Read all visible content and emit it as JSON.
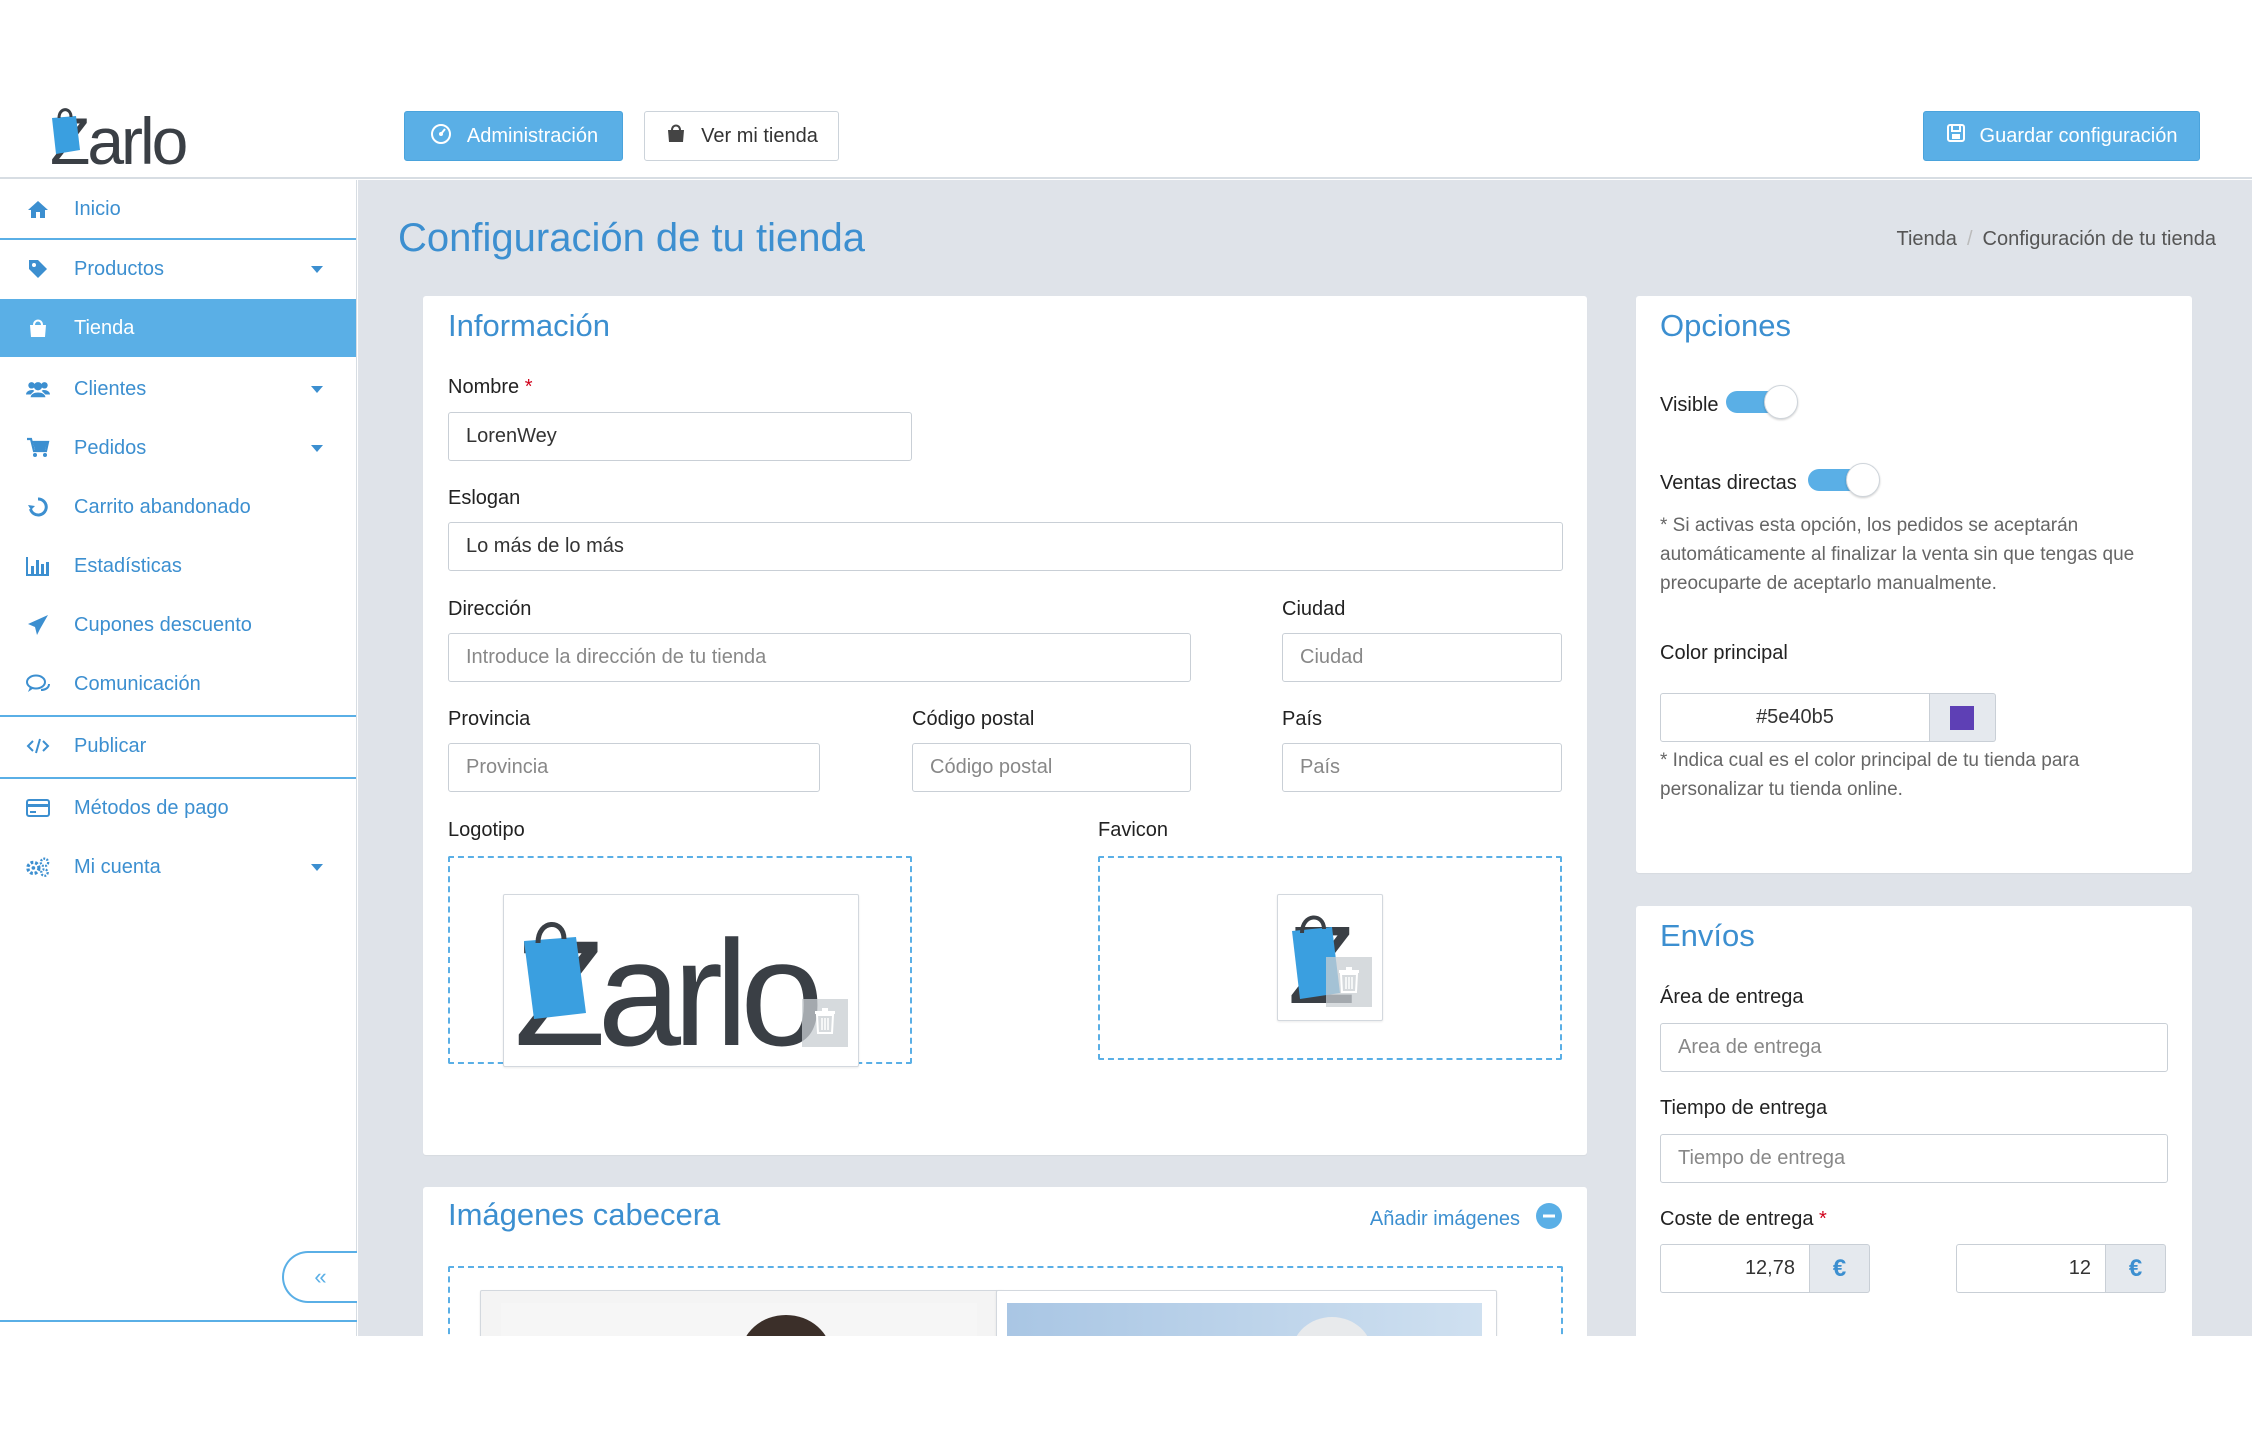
{
  "brand": {
    "logo_text": "Zarlo",
    "accent": "#5aafe6",
    "link": "#3c8fd0"
  },
  "topbar": {
    "admin_label": "Administración",
    "store_label": "Ver mi tienda",
    "save_label": "Guardar configuración"
  },
  "sidebar": {
    "items": [
      {
        "label": "Inicio",
        "icon": "home-icon"
      },
      {
        "label": "Productos",
        "icon": "tag-icon"
      },
      {
        "label": "Tienda",
        "icon": "shopping-bag-icon"
      },
      {
        "label": "Clientes",
        "icon": "users-icon"
      },
      {
        "label": "Pedidos",
        "icon": "cart-icon"
      },
      {
        "label": "Carrito abandonado",
        "icon": "recycle-icon"
      },
      {
        "label": "Estadísticas",
        "icon": "bar-chart-icon"
      },
      {
        "label": "Cupones descuento",
        "icon": "paper-plane-icon"
      },
      {
        "label": "Comunicación",
        "icon": "chat-icon"
      },
      {
        "label": "Publicar",
        "icon": "code-icon"
      },
      {
        "label": "Métodos de pago",
        "icon": "credit-card-icon"
      },
      {
        "label": "Mi cuenta",
        "icon": "gears-icon"
      }
    ],
    "collapse_glyph": "«"
  },
  "page": {
    "title": "Configuración de tu tienda",
    "breadcrumb": [
      "Tienda",
      "Configuración de tu tienda"
    ],
    "breadcrumb_sep": "/"
  },
  "info": {
    "title": "Información",
    "name_label": "Nombre",
    "required_mark": "*",
    "name_value": "LorenWey",
    "slogan_label": "Eslogan",
    "slogan_value": "Lo más de lo más",
    "address_label": "Dirección",
    "address_placeholder": "Introduce la dirección de tu tienda",
    "city_label": "Ciudad",
    "city_placeholder": "Ciudad",
    "province_label": "Provincia",
    "province_placeholder": "Provincia",
    "zip_label": "Código postal",
    "zip_placeholder": "Código postal",
    "country_label": "País",
    "country_placeholder": "País",
    "logo_label": "Logotipo",
    "favicon_label": "Favicon"
  },
  "header_images": {
    "title": "Imágenes cabecera",
    "add_label": "Añadir imágenes"
  },
  "options": {
    "title": "Opciones",
    "visible_label": "Visible",
    "visible_on": true,
    "direct_sales_label": "Ventas directas",
    "direct_sales_on": true,
    "direct_sales_note": "* Si activas esta opción, los pedidos se aceptarán automáticamente al finalizar la venta sin que tengas que preocuparte de aceptarlo manualmente.",
    "color_label": "Color principal",
    "color_value": "#5e40b5",
    "color_note": "* Indica cual es el color principal de tu tienda para personalizar tu tienda online."
  },
  "shipping": {
    "title": "Envíos",
    "area_label": "Área de entrega",
    "area_placeholder": "Area de entrega",
    "time_label": "Tiempo de entrega",
    "time_placeholder": "Tiempo de entrega",
    "cost_label": "Coste de entrega",
    "cost_value_1": "12,78",
    "cost_value_2": "12",
    "currency": "€"
  }
}
